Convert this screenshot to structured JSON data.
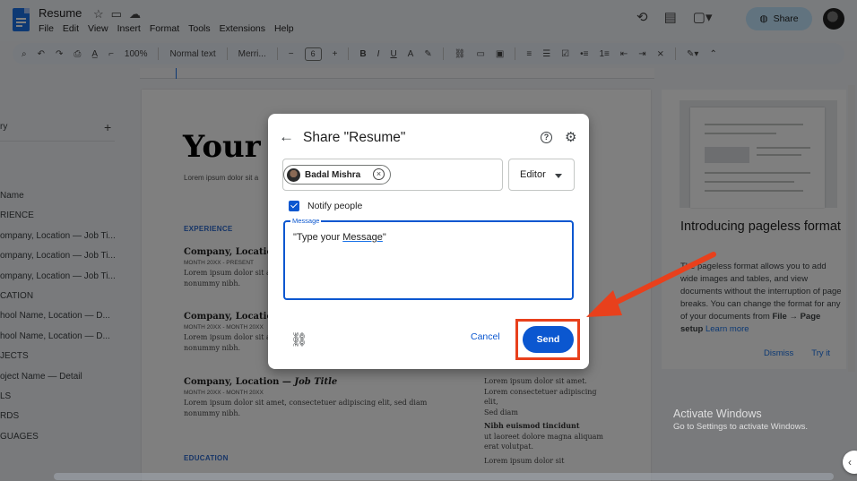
{
  "app": {
    "doc_title": "Resume",
    "menu": [
      "File",
      "Edit",
      "View",
      "Insert",
      "Format",
      "Tools",
      "Extensions",
      "Help"
    ],
    "share_label": "Share"
  },
  "toolbar": {
    "zoom": "100%",
    "style": "Normal text",
    "font": "Merri...",
    "font_size": "6"
  },
  "outline": {
    "head": "ry",
    "items": [
      "Name",
      "RIENCE",
      "ompany, Location — Job Ti...",
      "ompany, Location — Job Ti...",
      "ompany, Location — Job Ti...",
      "CATION",
      "hool Name, Location — D...",
      "hool Name, Location — D...",
      "JECTS",
      "oject Name — Detail",
      "LS",
      "RDS",
      "GUAGES"
    ]
  },
  "document": {
    "name_partial": "Your N",
    "subtitle": "Lorem ipsum dolor sit a",
    "experience_heading": "EXPERIENCE",
    "education_heading": "EDUCATION",
    "entries": [
      {
        "title": "Company, Location",
        "date": "MONTH 20XX - PRESENT",
        "body": "Lorem ipsum dolor sit amet, consectetuer adipiscing elit, sed diam nonummy nibh."
      },
      {
        "title": "Company, Location",
        "date": "MONTH 20XX - MONTH 20XX",
        "body": "Lorem ipsum dolor sit amet, consectetuer adipiscing elit, sed diam nonummy nibh."
      },
      {
        "title": "Company, Location — ",
        "title_italic": "Job Title",
        "date": "MONTH 20XX - MONTH 20XX",
        "body": "Lorem ipsum dolor sit amet, consectetuer adipiscing elit, sed diam nonummy nibh."
      }
    ],
    "side": {
      "line1": "Lorem ipsum dolor sit amet.",
      "line2": "Lorem consectetuer adipiscing elit,",
      "line3": "Sed diam",
      "bold1": "Nibh euismod tincidunt",
      "line4": "ut laoreet dolore magna aliquam erat volutpat.",
      "line5": "Lorem ipsum dolor sit"
    }
  },
  "panel": {
    "title": "Introducing pageless format",
    "body_pre": "The pageless format allows you to add wide images and tables, and view documents without the interruption of page breaks. You can change the format for any of your documents from ",
    "body_bold": "File → Page setup",
    "body_link": "Learn more",
    "dismiss": "Dismiss",
    "try_it": "Try it"
  },
  "watermark": {
    "line1": "Activate Windows",
    "line2": "Go to Settings to activate Windows."
  },
  "dialog": {
    "title": "Share \"Resume\"",
    "recipient": "Badal Mishra",
    "role": "Editor",
    "notify_label": "Notify people",
    "notify_checked": true,
    "message_label": "Message",
    "message_prefix": "\"Type your ",
    "message_underlined": "Message",
    "message_suffix": "\"",
    "cancel_label": "Cancel",
    "send_label": "Send"
  },
  "colors": {
    "accent": "#0b57d0",
    "highlight": "#e8401c",
    "share_bg": "#c2e7ff"
  }
}
